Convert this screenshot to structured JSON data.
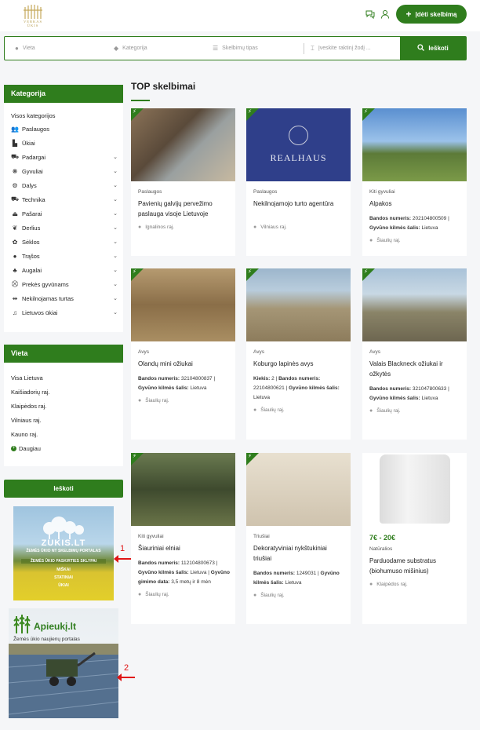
{
  "header": {
    "logo_text": "VERKAS ŪKIS",
    "add_button_label": "Įdėti skelbimą",
    "icons": [
      "chat-icon",
      "user-icon",
      "plus-icon"
    ]
  },
  "search": {
    "location_placeholder": "Vieta",
    "category_placeholder": "Kategorija",
    "type_placeholder": "Skelbimų tipas",
    "keyword_placeholder": "Įveskite raktinį žodį ...",
    "button_label": "Ieškoti"
  },
  "sidebar": {
    "categories_title": "Kategorija",
    "all_categories": "Visos kategorijos",
    "items": [
      {
        "label": "Paslaugos",
        "icon": "people-icon",
        "expandable": false
      },
      {
        "label": "Ūkiai",
        "icon": "factory-icon",
        "expandable": false
      },
      {
        "label": "Padargai",
        "icon": "tractor-icon",
        "expandable": true
      },
      {
        "label": "Gyvuliai",
        "icon": "paw-icon",
        "expandable": true
      },
      {
        "label": "Dalys",
        "icon": "gear-icon",
        "expandable": true
      },
      {
        "label": "Technika",
        "icon": "truck-icon",
        "expandable": true
      },
      {
        "label": "Pašarai",
        "icon": "eject-icon",
        "expandable": true
      },
      {
        "label": "Derlius",
        "icon": "leaf-icon",
        "expandable": true
      },
      {
        "label": "Sėklos",
        "icon": "seedling-icon",
        "expandable": true
      },
      {
        "label": "Trąšos",
        "icon": "drop-icon",
        "expandable": true
      },
      {
        "label": "Augalai",
        "icon": "tree-icon",
        "expandable": true
      },
      {
        "label": "Prekės gyvūnams",
        "icon": "cart-icon",
        "expandable": true
      },
      {
        "label": "Nekilnojamas turtas",
        "icon": "signpost-icon",
        "expandable": true
      },
      {
        "label": "Lietuvos ūkiai",
        "icon": "bell-icon",
        "expandable": true
      }
    ],
    "location_title": "Vieta",
    "locations": [
      "Visa Lietuva",
      "Kaišiadorių raj.",
      "Klaipėdos raj.",
      "Vilniaus raj.",
      "Kauno raj."
    ],
    "more_label": "Daugiau",
    "search_button": "Ieškoti"
  },
  "banners": {
    "banner1": {
      "title": "ZUKIS.LT",
      "subtitle": "ŽEMĖS ŪKIO NT SKELBIMŲ PORTALAS",
      "line1": "ŽEMĖS ŪKIO PASKIRTIES SKLYPAI",
      "line2": "MIŠKAI",
      "line3": "STATINIAI",
      "line4": "ŪKIAI",
      "annotation": "1"
    },
    "banner2": {
      "title": "Apieukį.lt",
      "subtitle": "Žemės ūkio naujienų portalas",
      "annotation": "2"
    }
  },
  "main": {
    "section_title": "TOP skelbimai",
    "cards": [
      {
        "category": "Paslaugos",
        "title": "Pavienių galvijų pervežimo paslauga visoje Lietuvoje",
        "location": "Ignalinos raj.",
        "meta": []
      },
      {
        "category": "Paslaugos",
        "title": "Nekilnojamojo turto agentūra",
        "location": "Vilniaus raj.",
        "image_text": "REALHAUS",
        "meta": []
      },
      {
        "category": "Kiti gyvuliai",
        "title": "Alpakos",
        "location": "Šiaulių raj.",
        "meta": [
          {
            "k": "Bandos numeris:",
            "v": "202104800509"
          },
          {
            "k": "Gyvūno kilmės šalis:",
            "v": "Lietuva"
          }
        ]
      },
      {
        "category": "Avys",
        "title": "Olandų mini ožiukai",
        "location": "Šiaulių raj.",
        "meta": [
          {
            "k": "Bandos numeris:",
            "v": "32104800837"
          },
          {
            "k": "Gyvūno kilmės šalis:",
            "v": "Lietuva"
          }
        ]
      },
      {
        "category": "Avys",
        "title": "Koburgo lapinės avys",
        "location": "Šiaulių raj.",
        "meta": [
          {
            "k": "Kiekis:",
            "v": "2"
          },
          {
            "k": "Bandos numeris:",
            "v": "22104800621"
          },
          {
            "k": "Gyvūno kilmės šalis:",
            "v": "Lietuva"
          }
        ]
      },
      {
        "category": "Avys",
        "title": "Valais Blackneck ožiukai ir ožkytės",
        "location": "Šiaulių raj.",
        "meta": [
          {
            "k": "Bandos numeris:",
            "v": "321047800633"
          },
          {
            "k": "Gyvūno kilmės šalis:",
            "v": "Lietuva"
          }
        ]
      },
      {
        "category": "Kiti gyvuliai",
        "title": "Šiauriniai elniai",
        "location": "Šiaulių raj.",
        "meta": [
          {
            "k": "Bandos numeris:",
            "v": "112104800673"
          },
          {
            "k": "Gyvūno kilmės šalis:",
            "v": "Lietuva"
          },
          {
            "k": "Gyvūno gimimo data:",
            "v": "3,5 metų ir 8 mėn"
          }
        ]
      },
      {
        "category": "Triušiai",
        "title": "Dekoratyviniai nykštukiniai triušiai",
        "location": "Šiaulių raj.",
        "meta": [
          {
            "k": "Bandos numeris:",
            "v": "1249031"
          },
          {
            "k": "Gyvūno kilmės šalis:",
            "v": "Lietuva"
          }
        ]
      },
      {
        "category": "Natūralios",
        "title": "Parduodame substratus (biohumuso mišinius)",
        "location": "Klaipėdos raj.",
        "price": "7€ - 20€",
        "meta": []
      }
    ]
  },
  "colors": {
    "accent": "#2f7d1d",
    "annotation": "#e01515"
  }
}
